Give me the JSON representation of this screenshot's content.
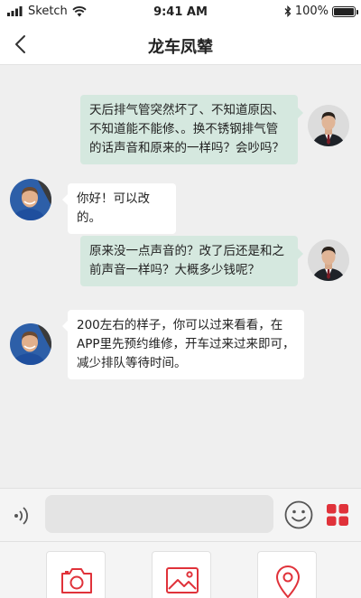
{
  "status_bar": {
    "carrier": "Sketch",
    "time": "9:41 AM",
    "battery": "100%",
    "battery_level": 1.0
  },
  "nav": {
    "title": "龙车凤辇"
  },
  "messages": [
    {
      "side": "out",
      "text": "天后排气管突然坏了、不知道原因、不知道能不能修、。换不锈钢排气管的话声音和原来的一样吗？会吵吗？"
    },
    {
      "side": "in",
      "text": "你好！可以改的。"
    },
    {
      "side": "out",
      "text": "原来没一点声音的？改了后还是和之前声音一样吗？大概多少钱呢？"
    },
    {
      "side": "in",
      "text": "200左右的样子，你可以过来看看，在APP里先预约维修，开车过来过来即可，减少排队等待时间。"
    }
  ],
  "input": {
    "value": "",
    "placeholder": ""
  },
  "tools": [
    {
      "icon": "camera-icon"
    },
    {
      "icon": "image-icon"
    },
    {
      "icon": "location-pin-icon"
    }
  ],
  "colors": {
    "accent": "#e0323a",
    "outgoing_bubble": "#d5e8df",
    "incoming_bubble": "#ffffff",
    "chat_background": "#efefef"
  }
}
